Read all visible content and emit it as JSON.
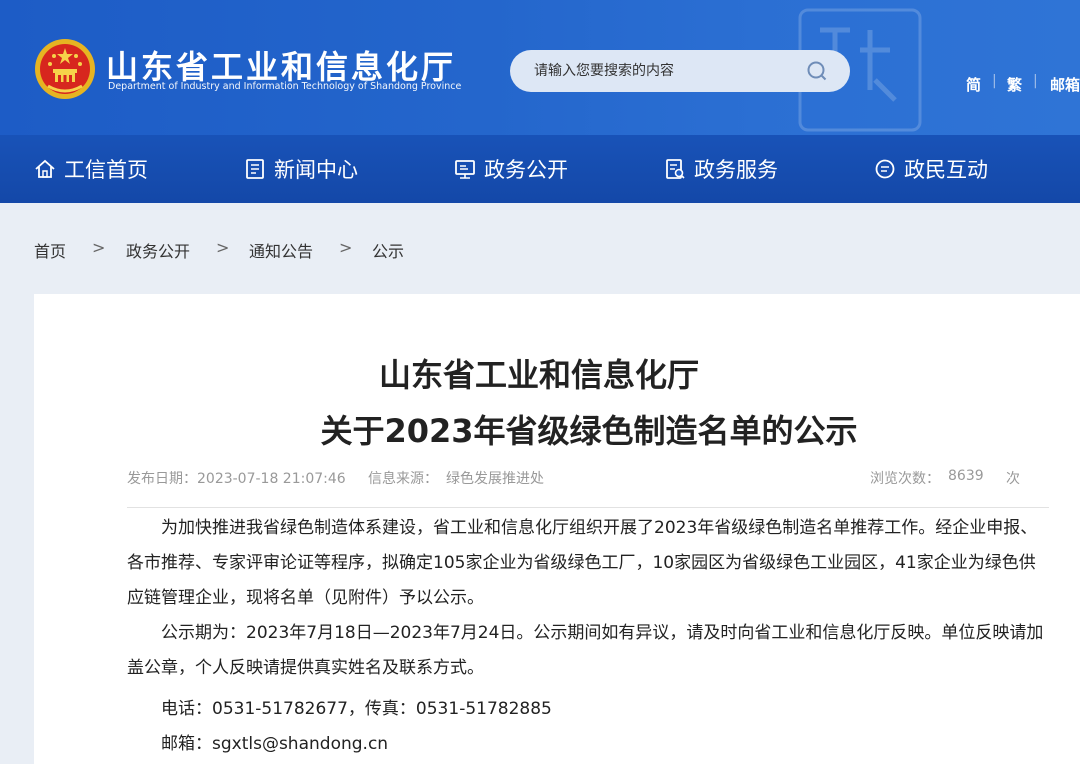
{
  "header": {
    "title": "山东省工业和信息化厅",
    "subtitle": "Department of Industry and Information Technology of Shandong Province",
    "search_placeholder": "请输入您要搜索的内容",
    "lang_simplified": "简",
    "lang_traditional": "繁",
    "mail": "邮箱",
    "separator": "|"
  },
  "nav": {
    "items": [
      {
        "label": "工信首页",
        "icon": "home-icon"
      },
      {
        "label": "新闻中心",
        "icon": "news-icon"
      },
      {
        "label": "政务公开",
        "icon": "monitor-icon"
      },
      {
        "label": "政务服务",
        "icon": "service-icon"
      },
      {
        "label": "政民互动",
        "icon": "chat-icon"
      }
    ]
  },
  "breadcrumb": {
    "items": [
      "首页",
      "政务公开",
      "通知公告",
      "公示"
    ],
    "separator": ">"
  },
  "article": {
    "title_line1": "山东省工业和信息化厅",
    "title_line2": "关于2023年省级绿色制造名单的公示",
    "publish_label": "发布日期：2023-07-18 21:07:46",
    "source_label": "信息来源：",
    "source_value": "绿色发展推进处",
    "views_label": "浏览次数：",
    "views_value": "8639",
    "views_unit": "次",
    "paragraph1": "为加快推进我省绿色制造体系建设，省工业和信息化厅组织开展了2023年省级绿色制造名单推荐工作。经企业申报、各市推荐、专家评审论证等程序，拟确定105家企业为省级绿色工厂，10家园区为省级绿色工业园区，41家企业为绿色供应链管理企业，现将名单（见附件）予以公示。",
    "paragraph2": "公示期为：2023年7月18日—2023年7月24日。公示期间如有异议，请及时向省工业和信息化厅反映。单位反映请加盖公章，个人反映请提供真实姓名及联系方式。",
    "phone_line": "电话：0531-51782677，传真：0531-51782885",
    "email_line": "邮箱：sgxtls@shandong.cn"
  },
  "colors": {
    "header_blue": "#1f5fc7",
    "search_bg": "#dde7f5",
    "page_bg": "#e9eef5"
  }
}
